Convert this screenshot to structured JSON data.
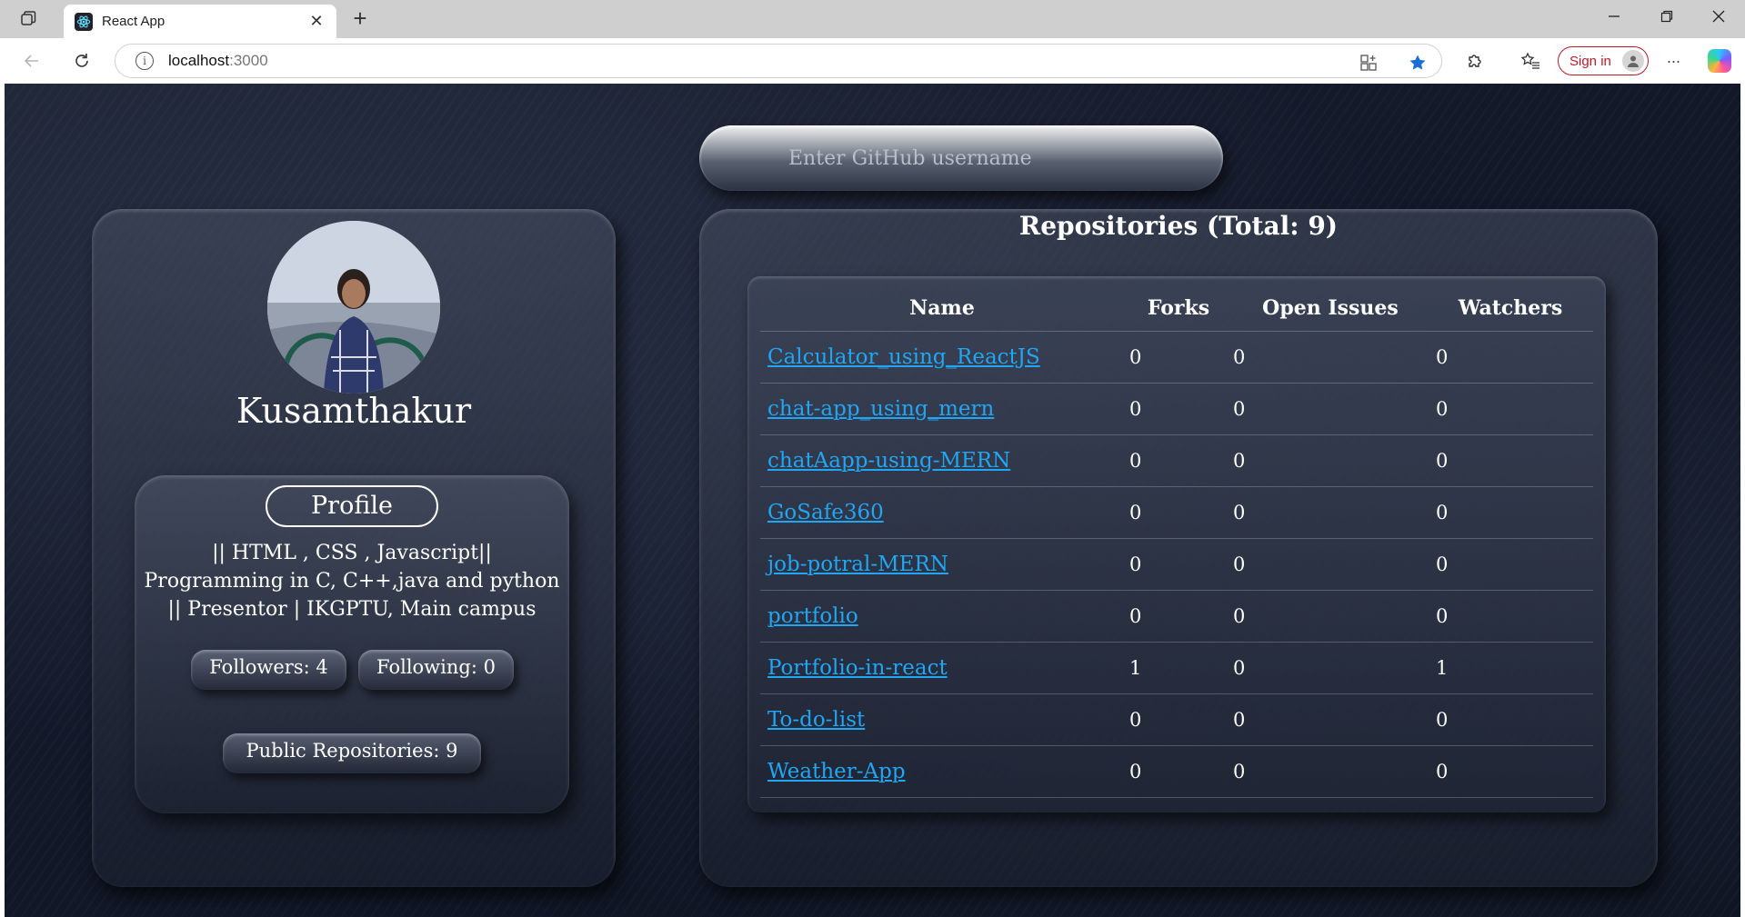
{
  "browser": {
    "tab_title": "React App",
    "url_host": "localhost",
    "url_port": ":3000",
    "sign_in_label": "Sign in",
    "new_tab_glyph": "+",
    "close_tab_glyph": "✕",
    "more_glyph": "···"
  },
  "search": {
    "placeholder": "Enter GitHub username",
    "value": ""
  },
  "profile": {
    "username": "Kusamthakur",
    "profile_label": "Profile",
    "bio": "|| HTML , CSS , Javascript|| Programming in C, C++,java and python || Presentor | IKGPTU, Main campus",
    "followers": "Followers: 4",
    "following": "Following: 0",
    "public_repos": "Public Repositories: 9"
  },
  "repositories": {
    "title": "Repositories (Total: 9)",
    "headers": [
      "Name",
      "Forks",
      "Open Issues",
      "Watchers"
    ],
    "rows": [
      {
        "name": "Calculator_using_ReactJS",
        "forks": "0",
        "open_issues": "0",
        "watchers": "0"
      },
      {
        "name": "chat-app_using_mern",
        "forks": "0",
        "open_issues": "0",
        "watchers": "0"
      },
      {
        "name": "chatAapp-using-MERN",
        "forks": "0",
        "open_issues": "0",
        "watchers": "0"
      },
      {
        "name": "GoSafe360",
        "forks": "0",
        "open_issues": "0",
        "watchers": "0"
      },
      {
        "name": "job-potral-MERN",
        "forks": "0",
        "open_issues": "0",
        "watchers": "0"
      },
      {
        "name": "portfolio",
        "forks": "0",
        "open_issues": "0",
        "watchers": "0"
      },
      {
        "name": "Portfolio-in-react",
        "forks": "1",
        "open_issues": "0",
        "watchers": "1"
      },
      {
        "name": "To-do-list",
        "forks": "0",
        "open_issues": "0",
        "watchers": "0"
      },
      {
        "name": "Weather-App",
        "forks": "0",
        "open_issues": "0",
        "watchers": "0"
      }
    ]
  },
  "colors": {
    "link": "#21a6f3",
    "background": "#121828",
    "sign_in_accent": "#c0192a"
  },
  "icons": {
    "workspaces": "workspaces-icon",
    "back": "back-arrow-icon",
    "reload": "reload-icon",
    "info": "site-info-icon",
    "favorite": "star-icon",
    "extensions": "puzzle-icon",
    "collections": "favorites-list-icon"
  }
}
